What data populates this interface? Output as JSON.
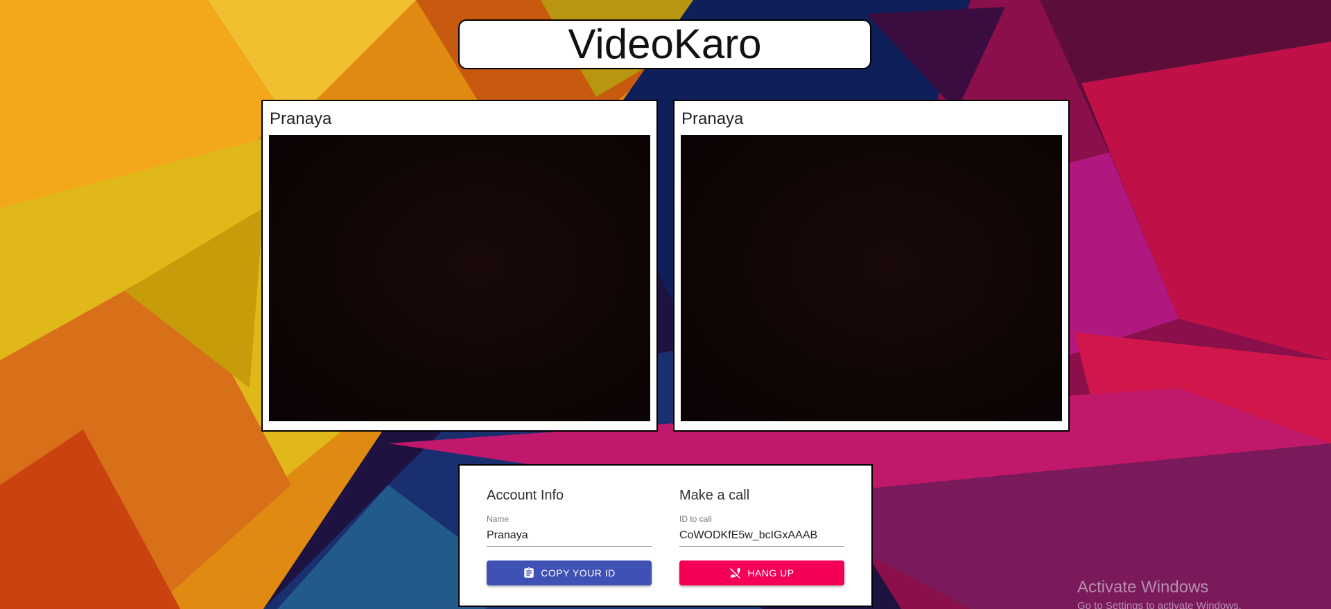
{
  "app": {
    "title": "VideoKaro"
  },
  "videos": [
    {
      "name": "Pranaya"
    },
    {
      "name": "Pranaya"
    }
  ],
  "options": {
    "account": {
      "heading": "Account Info",
      "name_label": "Name",
      "name_value": "Pranaya",
      "copy_button_label": "COPY YOUR ID",
      "copy_icon": "clipboard-icon"
    },
    "call": {
      "heading": "Make a call",
      "id_label": "ID to call",
      "id_value": "CoWODKfE5w_bcIGxAAAB",
      "hangup_button_label": "HANG UP",
      "hangup_icon": "phone-disabled-icon"
    }
  },
  "watermark": {
    "title": "Activate Windows",
    "subtitle": "Go to Settings to activate Windows."
  },
  "colors": {
    "primary": "#3f51b5",
    "secondary": "#f50057"
  }
}
